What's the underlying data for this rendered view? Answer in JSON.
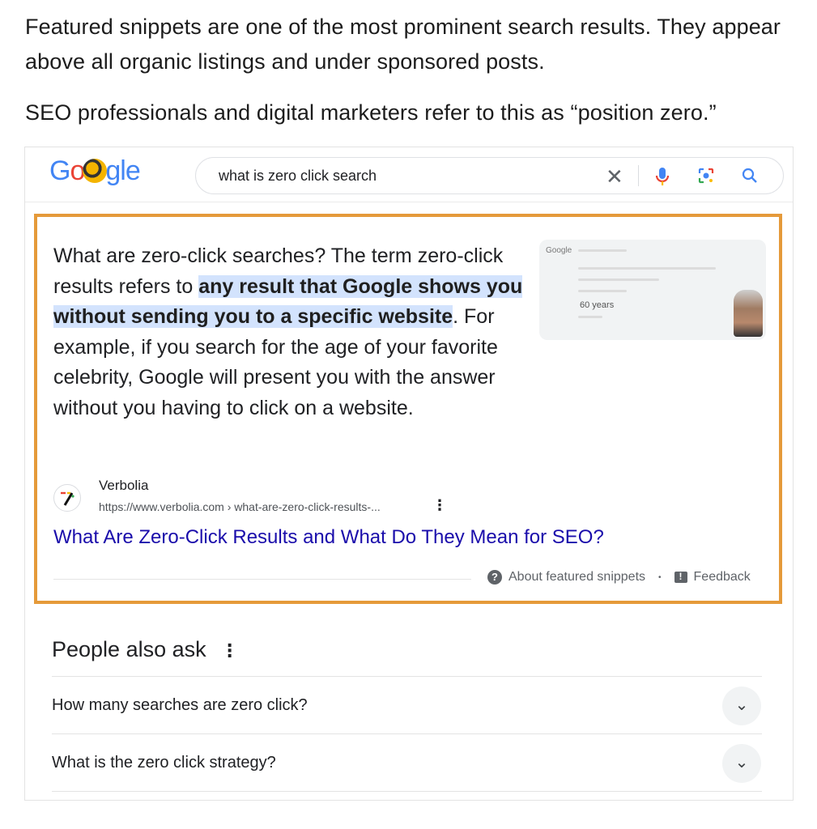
{
  "intro": {
    "p1": "Featured snippets are one of the most prominent search results. They appear above all organic listings and under sponsored posts.",
    "p2": "SEO professionals and digital marketers refer to this as “position zero.”"
  },
  "google": {
    "logo_letters": [
      "G",
      "o",
      "gle"
    ],
    "query": "what is zero click search",
    "clear_icon": "close-icon",
    "voice_icon": "mic-icon",
    "lens_icon": "lens-icon",
    "search_icon": "search-icon",
    "brand_colors": {
      "blue": "#4285f4",
      "red": "#ea4335",
      "yellow": "#fbbc05",
      "green": "#34a853"
    }
  },
  "snippet": {
    "border_color": "#e59a3a",
    "answer_before": "What are zero-click searches? The term zero-click results refers to ",
    "answer_highlight": "any result that Google shows you without sending you to a specific website",
    "answer_after": ". For example, if you search for the age of your favorite celebrity, Google will present you with the answer without you having to click on a website.",
    "thumbnail_text": "60 years",
    "source_name": "Verbolia",
    "source_url": "https://www.verbolia.com › what-are-zero-click-results-...",
    "more_icon": "more-vert-icon",
    "link_text": "What Are Zero-Click Results and What Do They Mean for SEO?",
    "about_label": "About featured snippets",
    "feedback_label": "Feedback",
    "separator": "•"
  },
  "people_also_ask": {
    "title": "People also ask",
    "questions": [
      "How many searches are zero click?",
      "What is the zero click strategy?"
    ]
  }
}
